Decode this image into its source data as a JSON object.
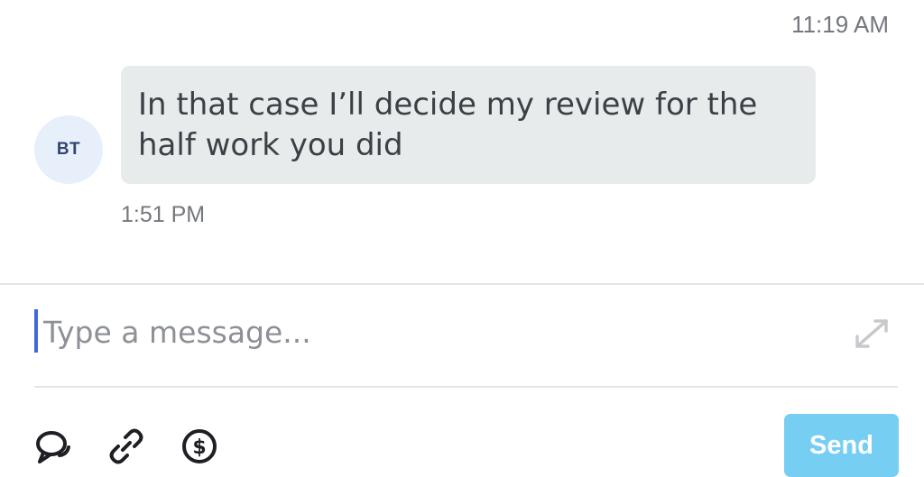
{
  "chat": {
    "top_timestamp": "11:19 AM",
    "message": {
      "avatar_initials": "BT",
      "text_line1": "In that case I’ll decide my review for the",
      "text_line2": "half work you did",
      "time": "1:51 PM"
    }
  },
  "composer": {
    "placeholder": "Type a message...",
    "send_label": "Send",
    "icons": [
      "expand-icon",
      "chat-bubbles-icon",
      "attachment-icon",
      "payment-dollar-icon"
    ],
    "colors": {
      "send_button": "#77cef3",
      "caret": "#3f67d8",
      "bubble": "#e8ebec",
      "avatar_bg": "#e7effb"
    }
  }
}
